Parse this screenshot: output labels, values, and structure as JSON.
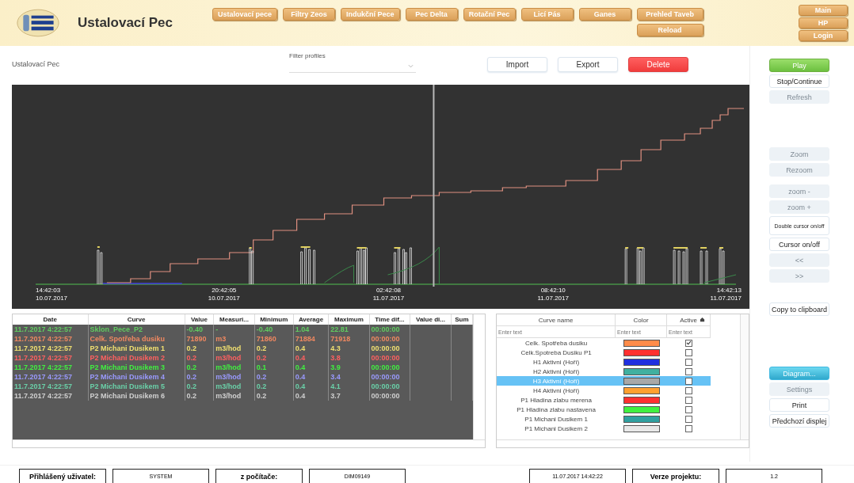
{
  "header": {
    "title": "Ustalovací Pec",
    "nav": [
      {
        "label": "Ustalovací pece"
      },
      {
        "label": "Filtry Zeos"
      },
      {
        "label": "Indukční Pece"
      },
      {
        "label": "Pec Delta"
      },
      {
        "label": "Rotační Pec"
      },
      {
        "label": "Licí Pás"
      },
      {
        "label": "Ganes"
      },
      {
        "label": "Prehled Taveb",
        "sub": "Reload"
      }
    ],
    "side_nav": [
      "Main",
      "HP",
      "Login"
    ]
  },
  "toolbar": {
    "page_label": "Ustalovací Pec",
    "filter_label": "Filter profiles",
    "buttons": [
      {
        "label": "Import",
        "kind": "normal"
      },
      {
        "label": "Export",
        "kind": "normal"
      },
      {
        "label": "Delete",
        "kind": "danger"
      }
    ]
  },
  "chart": {
    "ticks": [
      {
        "time": "14:42:03",
        "date": "10.07.2017"
      },
      {
        "time": "20:42:05",
        "date": "10.07.2017"
      },
      {
        "time": "02:42:08",
        "date": "11.07.2017"
      },
      {
        "time": "08:42:10",
        "date": "11.07.2017"
      },
      {
        "time": "14:42:13",
        "date": "11.07.2017"
      }
    ]
  },
  "side_buttons": [
    [
      {
        "label": "Play",
        "kind": "play",
        "disabled": false
      },
      {
        "label": "Stop/Continue",
        "kind": "normal",
        "disabled": false
      },
      {
        "label": "Refresh",
        "kind": "normal",
        "disabled": true
      }
    ],
    [
      {
        "label": "Zoom",
        "kind": "normal",
        "disabled": true
      },
      {
        "label": "Rezoom",
        "kind": "normal",
        "disabled": true
      }
    ],
    [
      {
        "label": "zoom -",
        "kind": "normal",
        "disabled": true
      },
      {
        "label": "zoom +",
        "kind": "normal",
        "disabled": true
      },
      {
        "label": "Double cursor on/off",
        "kind": "small",
        "disabled": false
      },
      {
        "label": "Cursor on/off",
        "kind": "normal",
        "disabled": false
      },
      {
        "label": "<<",
        "kind": "normal",
        "disabled": true
      },
      {
        "label": ">>",
        "kind": "normal",
        "disabled": true
      }
    ],
    [
      {
        "label": "Copy to clipboard",
        "kind": "normal",
        "disabled": false
      }
    ],
    [
      {
        "label": "Diagram...",
        "kind": "highlight",
        "disabled": true
      },
      {
        "label": "Settings",
        "kind": "normal",
        "disabled": true
      },
      {
        "label": "Print",
        "kind": "normal",
        "disabled": false
      },
      {
        "label": "Předchozí displej",
        "kind": "normal",
        "disabled": false
      }
    ]
  ],
  "data_table": {
    "columns": [
      "Date",
      "Curve",
      "Value",
      "Measuri...",
      "Minimum",
      "Average",
      "Maximum",
      "Time dif...",
      "Value di...",
      "Sum"
    ],
    "rows": [
      {
        "color": "#60cc60",
        "cells": [
          "11.7.2017 4:22:57",
          "Sklon_Pece_P2",
          "-0.40",
          "-",
          "-0.40",
          "1.04",
          "22.81",
          "00:00:00"
        ]
      },
      {
        "color": "#f08860",
        "cells": [
          "11.7.2017 4:22:57",
          "Celk. Spotřeba dusiku",
          "71890",
          "m3",
          "71860",
          "71884",
          "71918",
          "00:00:00"
        ]
      },
      {
        "color": "#f0e070",
        "cells": [
          "11.7.2017 4:22:57",
          "P2 Michani Dusikem 1",
          "0.2",
          "m3/hod",
          "0.2",
          "0.4",
          "4.3",
          "00:00:00"
        ]
      },
      {
        "color": "#ff6060",
        "cells": [
          "11.7.2017 4:22:57",
          "P2 Michani Dusikem 2",
          "0.2",
          "m3/hod",
          "0.2",
          "0.4",
          "3.8",
          "00:00:00"
        ]
      },
      {
        "color": "#40f040",
        "cells": [
          "11.7.2017 4:22:57",
          "P2 Michani Dusikem 3",
          "0.2",
          "m3/hod",
          "0.1",
          "0.4",
          "3.9",
          "00:00:00"
        ]
      },
      {
        "color": "#9a9aff",
        "cells": [
          "11.7.2017 4:22:57",
          "P2 Michani Dusikem 4",
          "0.2",
          "m3/hod",
          "0.2",
          "0.4",
          "3.4",
          "00:00:00"
        ]
      },
      {
        "color": "#6ad0a8",
        "cells": [
          "11.7.2017 4:22:57",
          "P2 Michani Dusikem 5",
          "0.2",
          "m3/hod",
          "0.2",
          "0.4",
          "4.1",
          "00:00:00"
        ]
      },
      {
        "color": "#d0d0d0",
        "cells": [
          "11.7.2017 4:22:57",
          "P2 Michani Dusikem 6",
          "0.2",
          "m3/hod",
          "0.2",
          "0.4",
          "3.7",
          "00:00:00"
        ]
      }
    ]
  },
  "curves_table": {
    "columns": [
      "Curve name",
      "Color",
      "Active"
    ],
    "filter_placeholders": [
      "Enter text",
      "Enter text",
      "Enter text"
    ],
    "rows": [
      {
        "name": "Celk. Spotřeba dusiku",
        "color": "#ff8c4a",
        "active": true,
        "selected": false
      },
      {
        "name": "Celk.Spotreba Dusiku P1",
        "color": "#ff3030",
        "active": false,
        "selected": false
      },
      {
        "name": "H1 Aktivni (Hoří)",
        "color": "#2030e0",
        "active": false,
        "selected": false
      },
      {
        "name": "H2 Aktivni (Hoří)",
        "color": "#40b0a0",
        "active": false,
        "selected": false
      },
      {
        "name": "H3 Aktivní (Hoří)",
        "color": "#a8a8a8",
        "active": false,
        "selected": true
      },
      {
        "name": "H4 Aktivni (Hoří)",
        "color": "#ffa030",
        "active": false,
        "selected": false
      },
      {
        "name": "P1 Hladina zlabu merena",
        "color": "#ff3030",
        "active": false,
        "selected": false
      },
      {
        "name": "P1 Hladina zlabu nastavena",
        "color": "#40f040",
        "active": false,
        "selected": false
      },
      {
        "name": "P1 Michani Dusikem 1",
        "color": "#30a0a0",
        "active": false,
        "selected": false
      },
      {
        "name": "P1 Michani Dusikem 2",
        "color": "#e8e8e8",
        "active": false,
        "selected": false
      }
    ]
  },
  "status_bar": {
    "user_label": "Přihlášený uživatel:",
    "user": "SYSTEM",
    "computer_label": "z počítače:",
    "computer": "DIM09149",
    "datetime": "11.07.2017 14:42:22",
    "version_label": "Verze projektu:",
    "version": "1.2"
  }
}
